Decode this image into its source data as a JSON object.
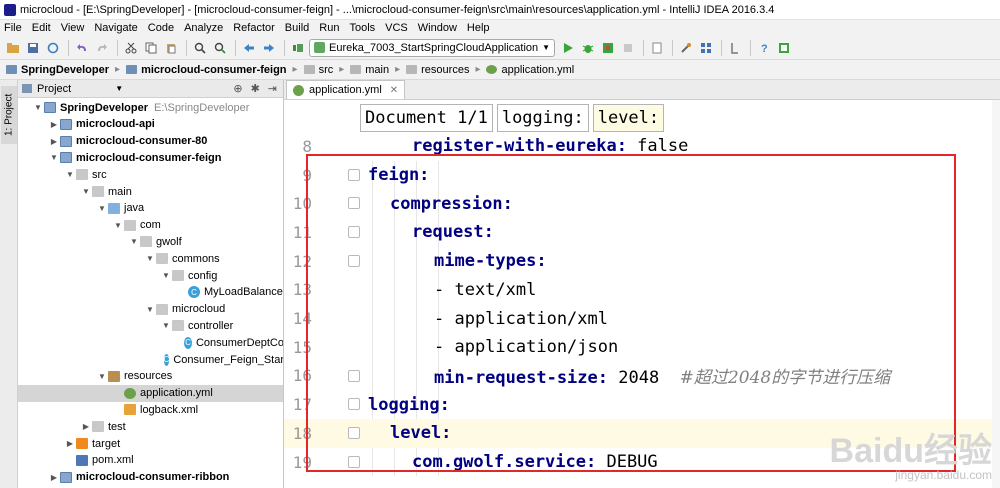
{
  "window": {
    "title": "microcloud - [E:\\SpringDeveloper] - [microcloud-consumer-feign] - ...\\microcloud-consumer-feign\\src\\main\\resources\\application.yml - IntelliJ IDEA 2016.3.4"
  },
  "menu": [
    "File",
    "Edit",
    "View",
    "Navigate",
    "Code",
    "Analyze",
    "Refactor",
    "Build",
    "Run",
    "Tools",
    "VCS",
    "Window",
    "Help"
  ],
  "toolbar": {
    "run_config": "Eureka_7003_StartSpringCloudApplication"
  },
  "breadcrumbs": [
    "SpringDeveloper",
    "microcloud-consumer-feign",
    "src",
    "main",
    "resources",
    "application.yml"
  ],
  "sidestrip": {
    "label": "1: Project"
  },
  "project": {
    "header": "Project",
    "tree": [
      {
        "label": "SpringDeveloper",
        "path": "E:\\SpringDeveloper",
        "depth": 0,
        "icon": "module-icon",
        "bold": true,
        "expanded": true
      },
      {
        "label": "microcloud-api",
        "depth": 1,
        "icon": "module-icon",
        "bold": true,
        "expanded": false
      },
      {
        "label": "microcloud-consumer-80",
        "depth": 1,
        "icon": "module-icon",
        "bold": true,
        "expanded": false
      },
      {
        "label": "microcloud-consumer-feign",
        "depth": 1,
        "icon": "module-icon",
        "bold": true,
        "expanded": true
      },
      {
        "label": "src",
        "depth": 2,
        "icon": "folder-icon",
        "expanded": true
      },
      {
        "label": "main",
        "depth": 3,
        "icon": "folder-icon",
        "expanded": true
      },
      {
        "label": "java",
        "depth": 4,
        "icon": "source-folder-icon",
        "expanded": true
      },
      {
        "label": "com",
        "depth": 5,
        "icon": "package-icon",
        "expanded": true
      },
      {
        "label": "gwolf",
        "depth": 6,
        "icon": "package-icon",
        "expanded": true
      },
      {
        "label": "commons",
        "depth": 7,
        "icon": "package-icon",
        "expanded": true
      },
      {
        "label": "config",
        "depth": 8,
        "icon": "package-icon",
        "expanded": true
      },
      {
        "label": "MyLoadBalance",
        "depth": 9,
        "icon": "class-icon",
        "leaf": true
      },
      {
        "label": "microcloud",
        "depth": 7,
        "icon": "package-icon",
        "expanded": true
      },
      {
        "label": "controller",
        "depth": 8,
        "icon": "package-icon",
        "expanded": true
      },
      {
        "label": "ConsumerDeptCo",
        "depth": 9,
        "icon": "class-icon",
        "leaf": true
      },
      {
        "label": "Consumer_Feign_Star",
        "depth": 8,
        "icon": "spring-class-icon",
        "leaf": true
      },
      {
        "label": "resources",
        "depth": 4,
        "icon": "resources-folder-icon",
        "expanded": true
      },
      {
        "label": "application.yml",
        "depth": 5,
        "icon": "yml-file-icon",
        "leaf": true,
        "selected": true
      },
      {
        "label": "logback.xml",
        "depth": 5,
        "icon": "xml-file-icon",
        "leaf": true
      },
      {
        "label": "test",
        "depth": 3,
        "icon": "folder-icon",
        "expanded": false
      },
      {
        "label": "target",
        "depth": 2,
        "icon": "target-folder-icon",
        "expanded": false
      },
      {
        "label": "pom.xml",
        "depth": 2,
        "icon": "maven-pom-icon",
        "leaf": true
      },
      {
        "label": "microcloud-consumer-ribbon",
        "depth": 1,
        "icon": "module-icon",
        "bold": true,
        "expanded": false
      }
    ]
  },
  "editor": {
    "tab": "application.yml",
    "find_chips": [
      "Document 1/1",
      "logging:",
      "level:"
    ],
    "current_line": 18,
    "lines": [
      {
        "num": "8",
        "indent": 2,
        "key": "register-with-eureka:",
        "value": " false",
        "comment": ""
      },
      {
        "num": "9",
        "indent": 0,
        "key": "feign:",
        "value": "",
        "comment": ""
      },
      {
        "num": "10",
        "indent": 1,
        "key": "compression:",
        "value": "",
        "comment": ""
      },
      {
        "num": "11",
        "indent": 2,
        "key": "request:",
        "value": "",
        "comment": ""
      },
      {
        "num": "12",
        "indent": 3,
        "key": "mime-types:",
        "value": "",
        "comment": ""
      },
      {
        "num": "13",
        "indent": 3,
        "key": "",
        "value": "- text/xml",
        "comment": ""
      },
      {
        "num": "14",
        "indent": 3,
        "key": "",
        "value": "- application/xml",
        "comment": ""
      },
      {
        "num": "15",
        "indent": 3,
        "key": "",
        "value": "- application/json",
        "comment": ""
      },
      {
        "num": "16",
        "indent": 3,
        "key": "min-request-size:",
        "value": " 2048  ",
        "comment": "#超过2048的字节进行压缩"
      },
      {
        "num": "17",
        "indent": 0,
        "key": "logging:",
        "value": "",
        "comment": ""
      },
      {
        "num": "18",
        "indent": 1,
        "key": "level:",
        "value": "",
        "comment": ""
      },
      {
        "num": "19",
        "indent": 2,
        "key": "com.gwolf.service:",
        "value": " DEBUG",
        "comment": ""
      }
    ]
  },
  "watermark": {
    "logo": "Baidu经验",
    "url": "jingyan.baidu.com"
  },
  "colors": {
    "yaml_key": "#000080",
    "comment": "#808080",
    "current_line": "#fffae3",
    "annotation_box": "#e0282a"
  }
}
